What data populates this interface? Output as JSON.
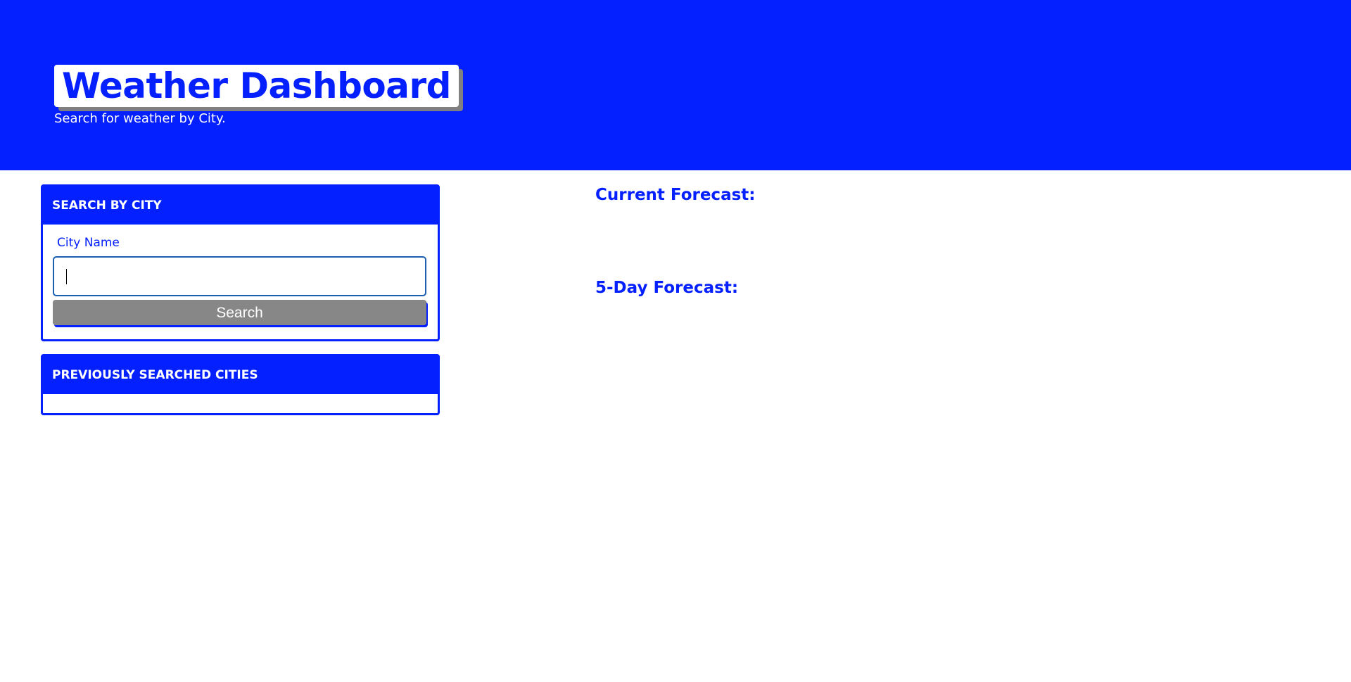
{
  "header": {
    "title": "Weather Dashboard",
    "subtitle": "Search for weather by City."
  },
  "search_card": {
    "heading": "SEARCH BY CITY",
    "field_label": "City Name",
    "input_value": "",
    "button_label": "Search"
  },
  "history_card": {
    "heading": "PREVIOUSLY SEARCHED CITIES",
    "cities": []
  },
  "forecast": {
    "current_heading": "Current Forecast:",
    "five_day_heading": "5-Day Forecast:"
  },
  "colors": {
    "primary": "#0520ff",
    "button": "#878787",
    "shadow": "#808080"
  }
}
